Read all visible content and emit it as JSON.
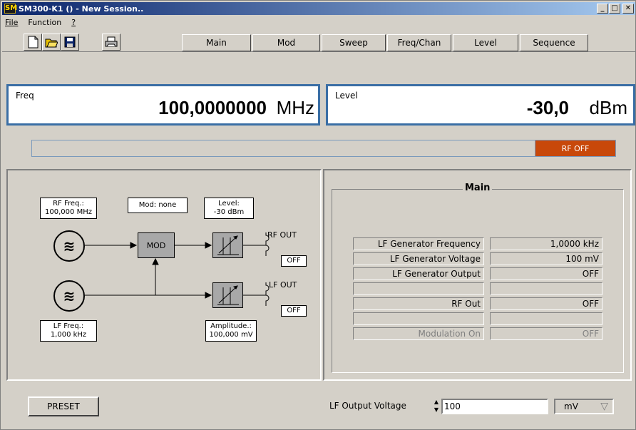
{
  "window": {
    "title": "SM300-K1 () - New Session..",
    "icon_text": "SM"
  },
  "menu": {
    "file": "File",
    "function": "Function",
    "help": "?"
  },
  "toolbar": {
    "icons": [
      "new-icon",
      "open-icon",
      "save-icon",
      "print-icon"
    ],
    "tabs": [
      "Main",
      "Mod",
      "Sweep",
      "Freq/Chan",
      "Level",
      "Sequence"
    ]
  },
  "freq": {
    "label": "Freq",
    "value": "100,0000000",
    "unit": "MHz"
  },
  "level": {
    "label": "Level",
    "value": "-30,0",
    "unit": "dBm"
  },
  "rf_status": "RF OFF",
  "diagram": {
    "rf_freq": [
      "RF Freq.:",
      "100,000 MHz"
    ],
    "mod_info": "Mod: none",
    "level_info": [
      "Level:",
      "-30 dBm"
    ],
    "mod_block": "MOD",
    "rf_out": "RF OUT",
    "rf_out_state": "OFF",
    "lf_out": "LF OUT",
    "lf_out_state": "OFF",
    "lf_freq": [
      "LF Freq.:",
      "1,000 kHz"
    ],
    "amplitude": [
      "Amplitude.:",
      "100,000 mV"
    ]
  },
  "main_panel": {
    "title": "Main",
    "rows": [
      {
        "label": "LF Generator Frequency",
        "value": "1,0000 kHz",
        "dim": false
      },
      {
        "label": "LF Generator Voltage",
        "value": "100 mV",
        "dim": false
      },
      {
        "label": "LF Generator Output",
        "value": "OFF",
        "dim": false
      },
      {
        "label": "",
        "value": "",
        "dim": false
      },
      {
        "label": "RF Out",
        "value": "OFF",
        "dim": false
      },
      {
        "label": "",
        "value": "",
        "dim": false
      },
      {
        "label": "Modulation On",
        "value": "OFF",
        "dim": true
      }
    ]
  },
  "bottom": {
    "preset": "PRESET",
    "lf_output_label": "LF Output Voltage",
    "lf_output_value": "100",
    "unit": "mV"
  },
  "colors": {
    "titlebar": "#0a246a",
    "rf_off": "#c8480a",
    "readout_border": "#3a6ea5"
  }
}
